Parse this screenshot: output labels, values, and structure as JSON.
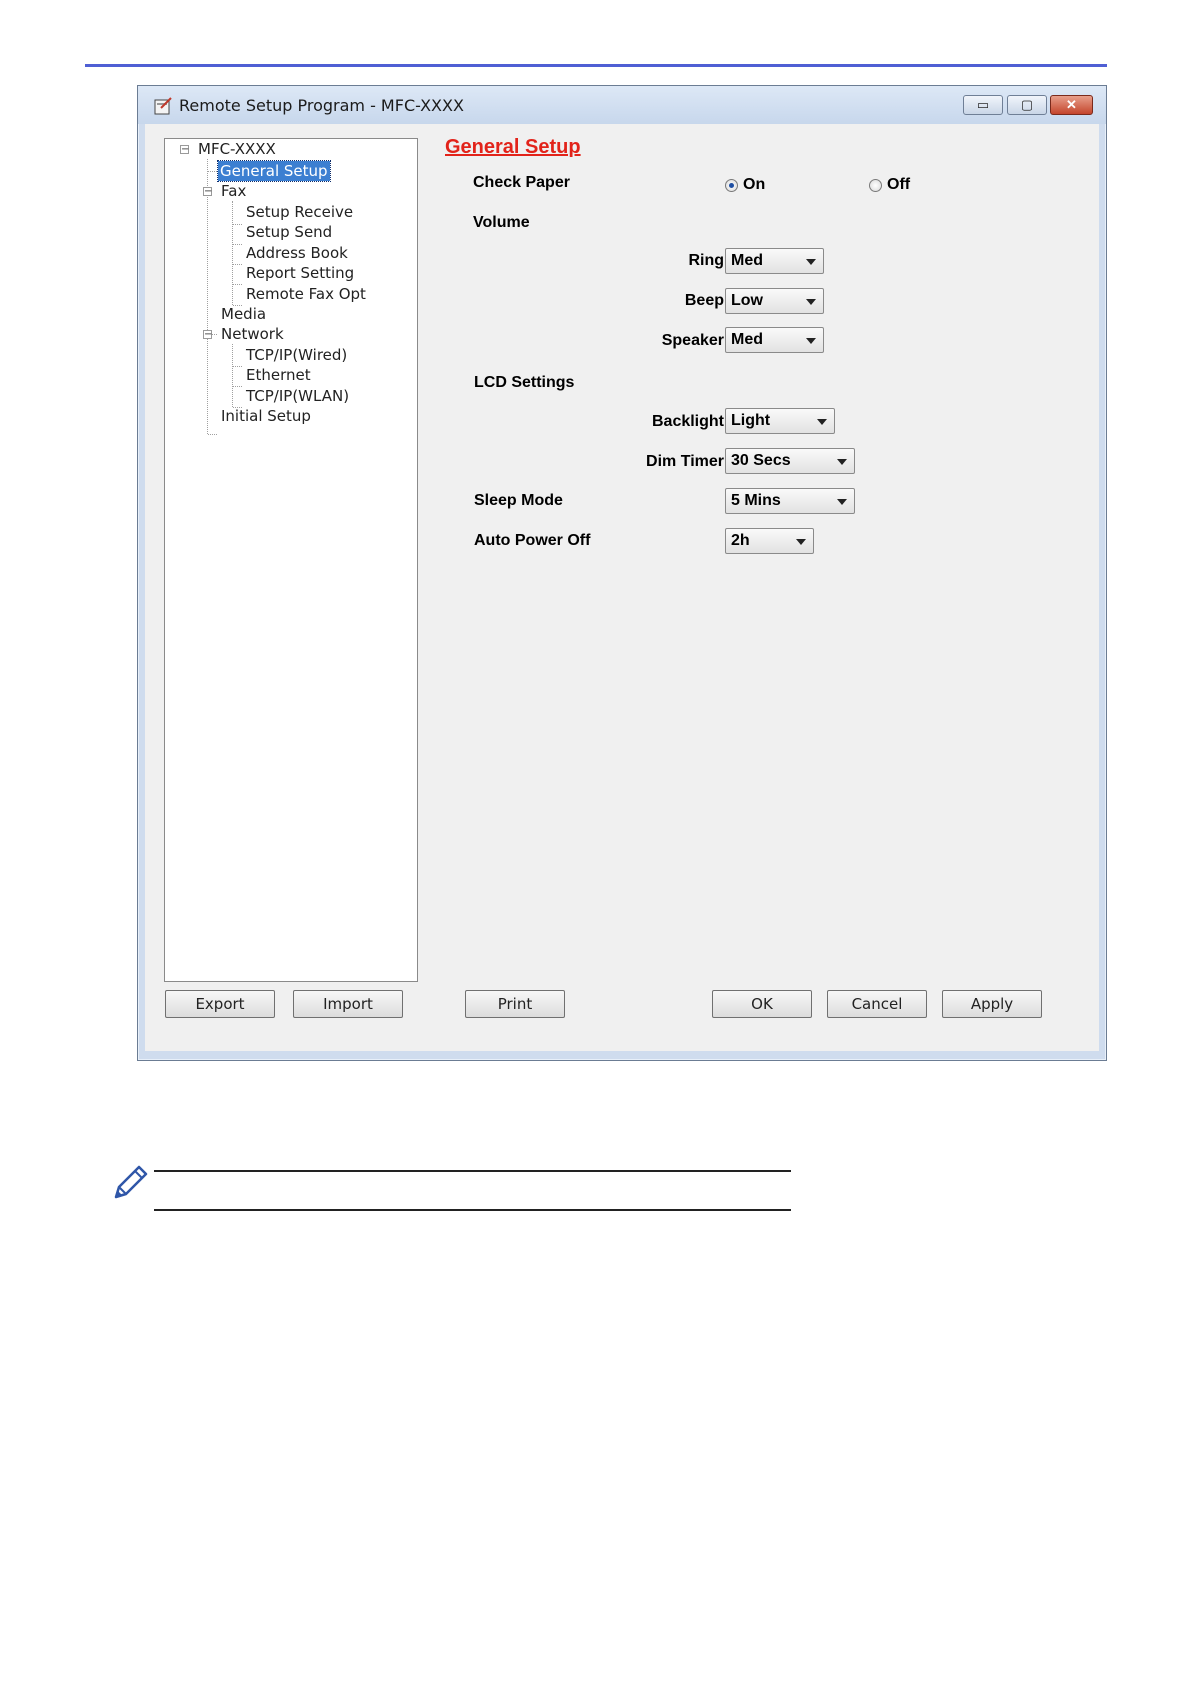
{
  "window": {
    "title": "Remote Setup Program - MFC-XXXX",
    "controls": {
      "minimize": "▭",
      "maximize": "▢",
      "close": "✕"
    }
  },
  "tree": {
    "root": "MFC-XXXX",
    "items": {
      "general_setup": "General Setup",
      "fax": "Fax",
      "setup_receive": "Setup Receive",
      "setup_send": "Setup Send",
      "address_book": "Address Book",
      "report_setting": "Report Setting",
      "remote_fax_opt": "Remote Fax Opt",
      "media": "Media",
      "network": "Network",
      "tcpip_wired": "TCP/IP(Wired)",
      "ethernet": "Ethernet",
      "tcpip_wlan": "TCP/IP(WLAN)",
      "initial_setup": "Initial Setup"
    },
    "selected": "General Setup"
  },
  "content": {
    "heading": "General Setup",
    "check_paper": {
      "label": "Check Paper",
      "on_label": "On",
      "off_label": "Off",
      "value": "On"
    },
    "volume": {
      "label": "Volume",
      "ring": {
        "label": "Ring",
        "value": "Med"
      },
      "beep": {
        "label": "Beep",
        "value": "Low"
      },
      "speaker": {
        "label": "Speaker",
        "value": "Med"
      }
    },
    "lcd": {
      "label": "LCD Settings",
      "backlight": {
        "label": "Backlight",
        "value": "Light"
      },
      "dim_timer": {
        "label": "Dim Timer",
        "value": "30 Secs"
      }
    },
    "sleep_mode": {
      "label": "Sleep Mode",
      "value": "5 Mins"
    },
    "auto_power_off": {
      "label": "Auto Power Off",
      "value": "2h"
    }
  },
  "buttons": {
    "export": "Export",
    "import": "Import",
    "print": "Print",
    "ok": "OK",
    "cancel": "Cancel",
    "apply": "Apply"
  },
  "colors": {
    "heading": "#e2231a",
    "top_rule": "#4f5fd4",
    "selection": "#3c7fd1"
  }
}
